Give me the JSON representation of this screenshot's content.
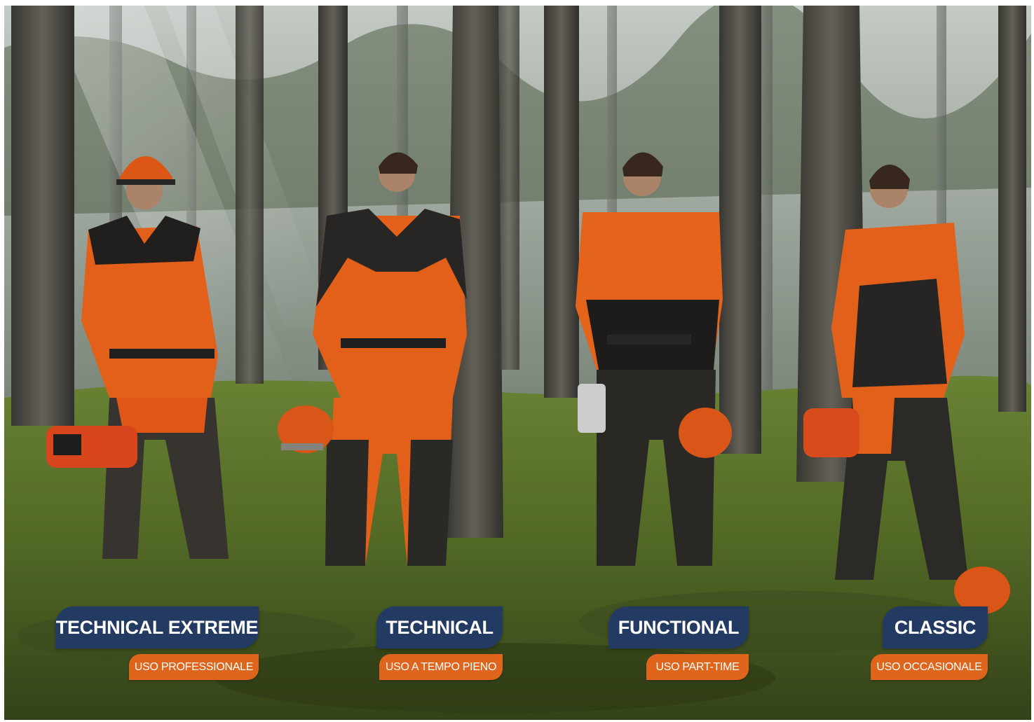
{
  "tiers": [
    {
      "title": "TECHNICAL EXTREME",
      "subtitle": "USO PROFESSIONALE"
    },
    {
      "title": "TECHNICAL",
      "subtitle": "USO A TEMPO PIENO"
    },
    {
      "title": "FUNCTIONAL",
      "subtitle": "USO PART-TIME"
    },
    {
      "title": "CLASSIC",
      "subtitle": "USO OCCASIONALE"
    }
  ],
  "colors": {
    "title_badge": "#233a63",
    "subtitle_badge": "#e0651c",
    "workwear_orange": "#f0661c",
    "forest_moss": "#5e7a2a"
  }
}
